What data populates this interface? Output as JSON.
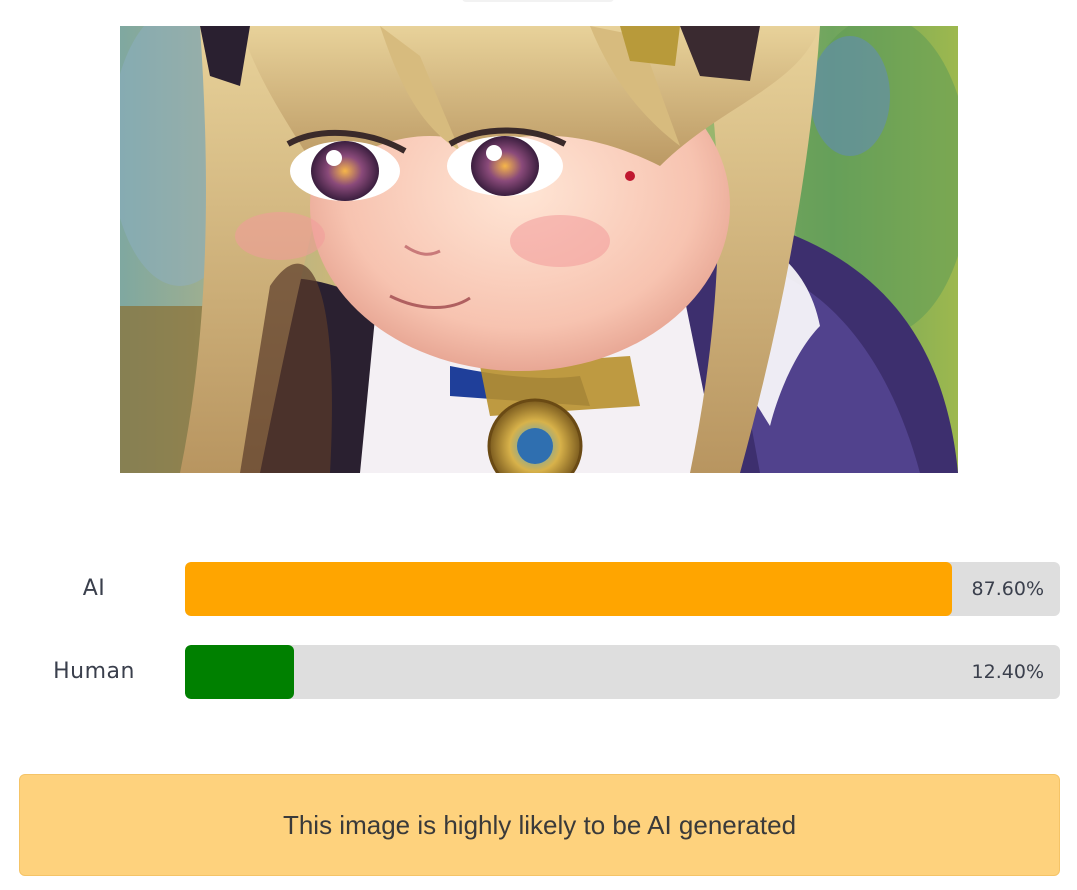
{
  "image": {
    "subject": "anime-girl-illustration"
  },
  "results": [
    {
      "label": "AI",
      "percent_text": "87.60%",
      "value": 87.6,
      "color": "#ffa500"
    },
    {
      "label": "Human",
      "percent_text": "12.40%",
      "value": 12.4,
      "color": "#008000"
    }
  ],
  "colors": {
    "track": "#dedede",
    "verdict_background": "#fed27d"
  },
  "verdict": {
    "text": "This image is highly likely to be AI generated"
  }
}
